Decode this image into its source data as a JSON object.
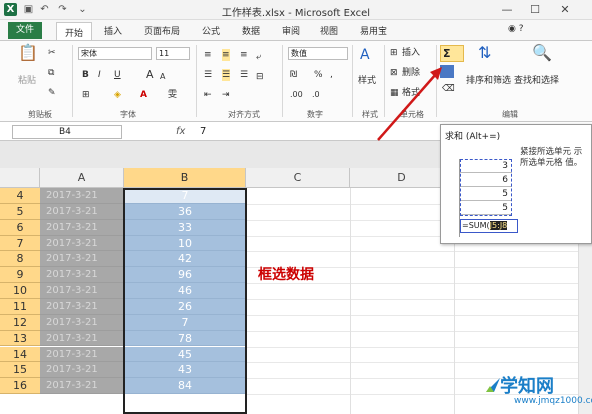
{
  "window": {
    "title": "工作样表.xlsx - Microsoft Excel",
    "logo": "X",
    "controls": [
      "—",
      "☐",
      "✕"
    ]
  },
  "ribbon_tabs": [
    "文件",
    "开始",
    "插入",
    "页面布局",
    "公式",
    "数据",
    "审阅",
    "视图",
    "易用宝"
  ],
  "ribbon": {
    "clipboard": {
      "label": "剪贴板",
      "paste": "粘贴"
    },
    "font": {
      "label": "字体",
      "name": "宋体",
      "size": "11",
      "bold": "B",
      "italic": "I",
      "underline": "U",
      "grow": "A",
      "shrink": "A",
      "wen": "雯"
    },
    "alignment": {
      "label": "对齐方式"
    },
    "number": {
      "label": "数字",
      "format": "数值",
      "percent": "%",
      "comma": ","
    },
    "styles": {
      "label": "样式",
      "button": "样式"
    },
    "cells": {
      "label": "单元格",
      "insert": "插入",
      "delete": "删除",
      "format": "格式"
    },
    "editing": {
      "label": "编辑",
      "sort": "排序和筛选",
      "find": "查找和选择",
      "sigma": "Σ"
    }
  },
  "formula_bar": {
    "name_box": "B4",
    "fx": "fx",
    "value": "7"
  },
  "sheet": {
    "columns": [
      "A",
      "B",
      "C",
      "D"
    ],
    "rows": [
      {
        "num": "4",
        "a": "2017-3-21",
        "b": "7"
      },
      {
        "num": "5",
        "a": "2017-3-21",
        "b": "36"
      },
      {
        "num": "6",
        "a": "2017-3-21",
        "b": "33"
      },
      {
        "num": "7",
        "a": "2017-3-21",
        "b": "10"
      },
      {
        "num": "8",
        "a": "2017-3-21",
        "b": "42"
      },
      {
        "num": "9",
        "a": "2017-3-21",
        "b": "96"
      },
      {
        "num": "10",
        "a": "2017-3-21",
        "b": "46"
      },
      {
        "num": "11",
        "a": "2017-3-21",
        "b": "26"
      },
      {
        "num": "12",
        "a": "2017-3-21",
        "b": "7"
      },
      {
        "num": "13",
        "a": "2017-3-21",
        "b": "78"
      },
      {
        "num": "14",
        "a": "2017-3-21",
        "b": "45"
      },
      {
        "num": "15",
        "a": "2017-3-21",
        "b": "43"
      },
      {
        "num": "16",
        "a": "2017-3-21",
        "b": "84"
      }
    ],
    "annotation": "框选数据"
  },
  "tooltip": {
    "title": "求和 (Alt+=)",
    "description": "紧接所选单元 示所选单元格 值。",
    "mini_values": [
      "3",
      "6",
      "5",
      "5"
    ],
    "formula_prefix": "=SUM(",
    "formula_highlight": "J5:J8"
  },
  "watermark": {
    "main": "学知网",
    "sub": "www.jmqz1000.com"
  },
  "colors": {
    "accent": "#2a7d46",
    "selection_fill": "#a5c0dd",
    "header_highlight": "#ffd88a",
    "annotation": "#cc0000"
  }
}
